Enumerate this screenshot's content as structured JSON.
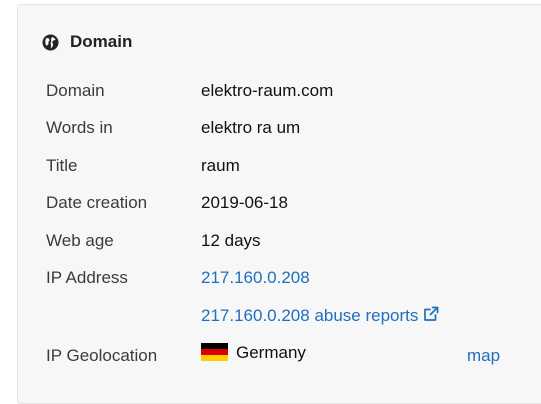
{
  "card": {
    "title": "Domain",
    "icon": "globe-icon"
  },
  "rows": [
    {
      "label": "Domain",
      "value": "elektro-raum.com"
    },
    {
      "label": "Words in",
      "value": "elektro ra um"
    },
    {
      "label": "Title",
      "value": "raum"
    },
    {
      "label": "Date creation",
      "value": "2019-06-18"
    },
    {
      "label": "Web age",
      "value": "12 days"
    },
    {
      "label": "IP Address",
      "value": "217.160.0.208"
    }
  ],
  "abuse": {
    "text": "217.160.0.208 abuse reports",
    "icon": "external-link-icon"
  },
  "geo": {
    "label": "IP Geolocation",
    "country": "Germany",
    "flag_colors": [
      "#000000",
      "#dd0000",
      "#ffce00"
    ],
    "map_label": "map"
  },
  "colors": {
    "link": "#1f6fbf"
  }
}
